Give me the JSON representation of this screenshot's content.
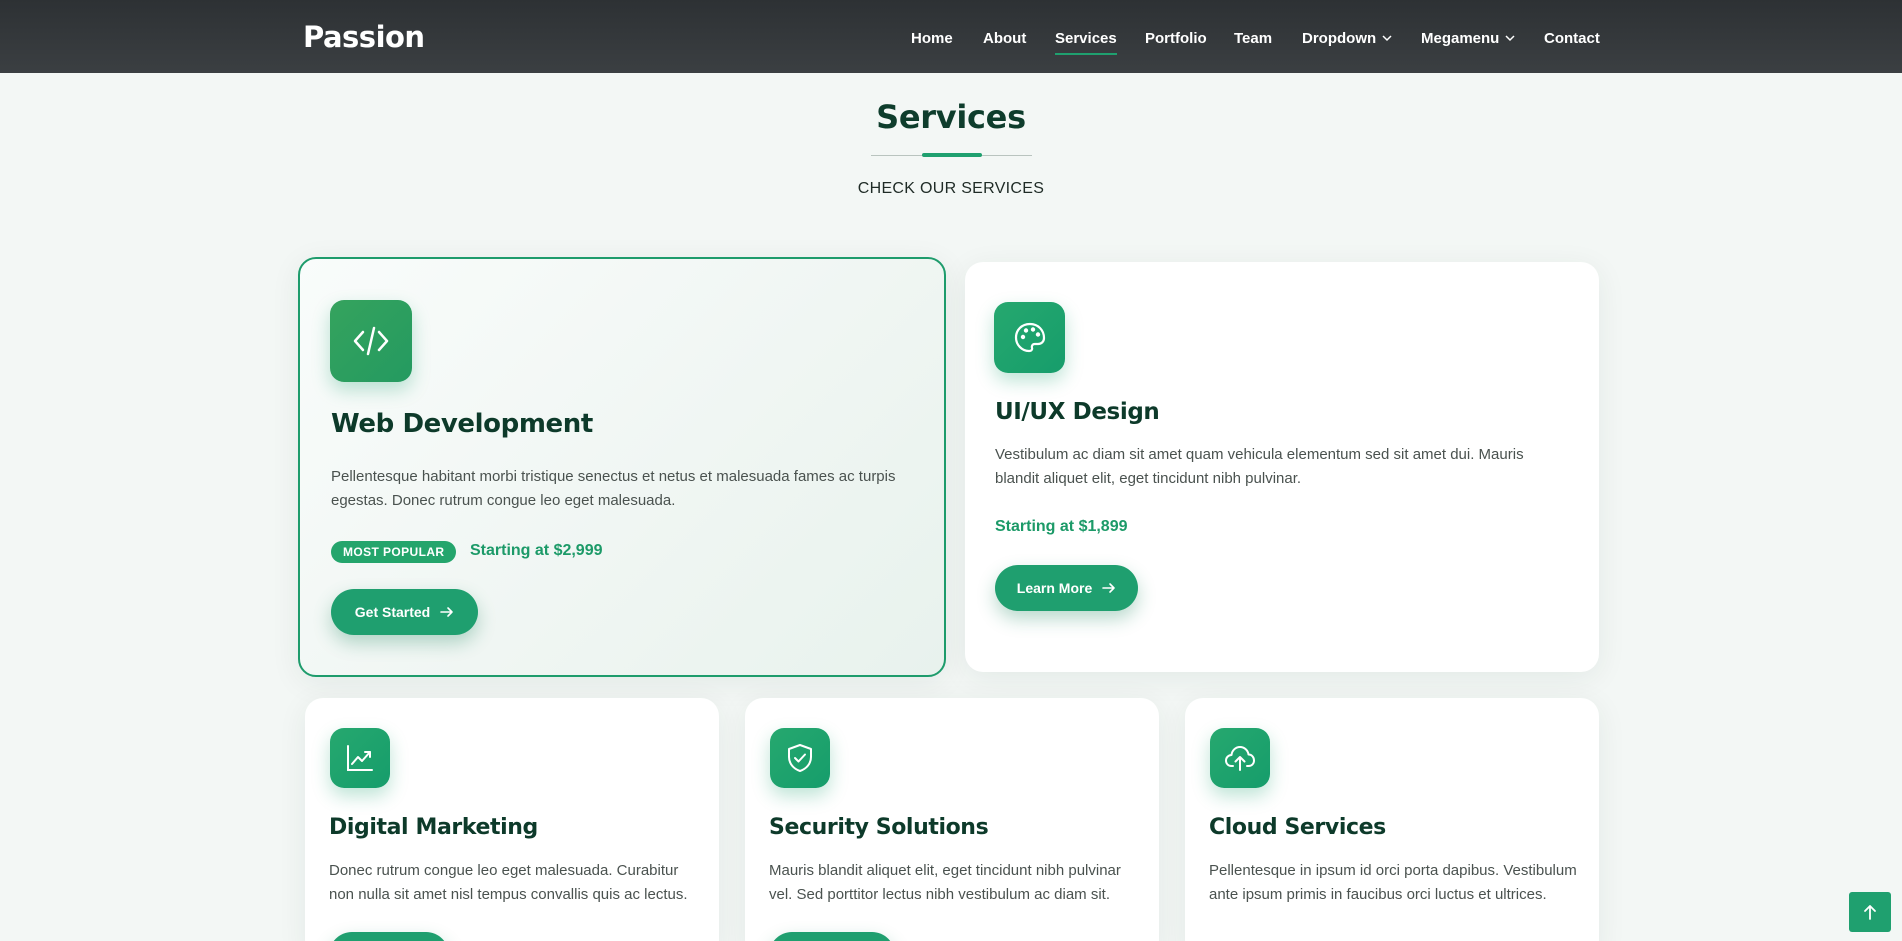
{
  "brand": {
    "logo": "Passion"
  },
  "nav": {
    "items": [
      {
        "label": "Home"
      },
      {
        "label": "About"
      },
      {
        "label": "Services",
        "active": true
      },
      {
        "label": "Portfolio"
      },
      {
        "label": "Team"
      },
      {
        "label": "Dropdown",
        "has_dropdown": true
      },
      {
        "label": "Megamenu",
        "has_dropdown": true
      },
      {
        "label": "Contact"
      }
    ]
  },
  "section": {
    "title": "Services",
    "subtitle": "CHECK OUR SERVICES"
  },
  "cards": [
    {
      "icon": "code-icon",
      "title": "Web Development",
      "description": "Pellentesque habitant morbi tristique senectus et netus et malesuada fames ac turpis egestas. Donec rutrum congue leo eget malesuada.",
      "badge": "MOST POPULAR",
      "price": "Starting at $2,999",
      "button": "Get Started"
    },
    {
      "icon": "palette-icon",
      "title": "UI/UX Design",
      "description": "Vestibulum ac diam sit amet quam vehicula elementum sed sit amet dui. Mauris blandit aliquet elit, eget tincidunt nibh pulvinar.",
      "price": "Starting at $1,899",
      "button": "Learn More"
    },
    {
      "icon": "chart-line-icon",
      "title": "Digital Marketing",
      "description": "Donec rutrum congue leo eget malesuada. Curabitur non nulla sit amet nisl tempus convallis quis ac lectus."
    },
    {
      "icon": "shield-check-icon",
      "title": "Security Solutions",
      "description": "Mauris blandit aliquet elit, eget tincidunt nibh pulvinar vel. Sed porttitor lectus nibh vestibulum ac diam sit."
    },
    {
      "icon": "cloud-upload-icon",
      "title": "Cloud Services",
      "description": "Pellentesque in ipsum id orci porta dapibus. Vestibulum ante ipsum primis in faucibus orci luctus et ultrices."
    }
  ],
  "scroll_top": {
    "icon": "arrow-up-icon"
  },
  "colors": {
    "accent": "#1fa06f",
    "header_bg": "#2d3134",
    "title": "#0d3a2a",
    "page_bg": "#f3f7f5"
  }
}
